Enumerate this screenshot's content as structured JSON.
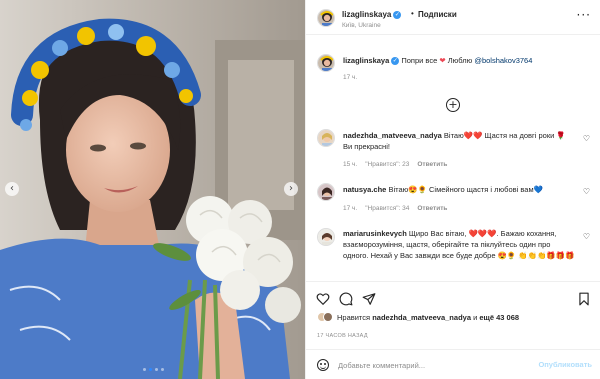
{
  "post": {
    "author": "lizaglinskaya",
    "follow_label": "Подписки",
    "header_separator": "•",
    "location": "Київ, Ukraine",
    "more_icon": "more-horizontal-icon"
  },
  "caption": {
    "username": "lizaglinskaya",
    "text_before": " Попри все ",
    "text_after": " Люблю ",
    "mention": "@bolshakov3764",
    "time": "17 ч."
  },
  "load_more_icon": "plus-circle-icon",
  "comments": [
    {
      "username": "nadezhda_matveeva_nadya",
      "text": " Вітаю❤️❤️ Щастя на довгі роки 🌹 Ви прекрасні!",
      "time": "15 ч.",
      "likes": "\"Нравится\": 23",
      "reply": "Ответить"
    },
    {
      "username": "natusya.che",
      "text": " Вітаю😍🌻 Сімейного щастя і любові вам💙",
      "time": "17 ч.",
      "likes": "\"Нравится\": 34",
      "reply": "Ответить"
    },
    {
      "username": "mariarusinkevych",
      "text": " Щиро Вас вітаю, ❤️❤️❤️. Бажаю кохання, взаєморозуміння, щастя, оберігайте та піклуйтесь один про одного. Нехай у Вас завжди все буде добре 😍🌻 👏👏👏🎁🎁🎁",
      "time": "",
      "likes": "",
      "reply": ""
    }
  ],
  "likes_line": {
    "prefix": "Нравится ",
    "user": "nadezhda_matveeva_nadya",
    "middle": " и ",
    "others": "ещё 43 068"
  },
  "post_time": "17 ЧАСОВ НАЗАД",
  "add_comment": {
    "placeholder": "Добавьте комментарий...",
    "publish_label": "Опубликовать"
  },
  "icons": [
    "heart-icon",
    "comment-icon",
    "share-icon",
    "bookmark-icon",
    "smile-icon",
    "chevron-left-icon",
    "chevron-right-icon"
  ],
  "colors": {
    "verified": "#3897f0",
    "link": "#00376b",
    "meta": "#8e8e8e",
    "publish_disabled": "#b2dffc",
    "wreath_blue": "#2b5fb3",
    "wreath_yellow": "#f2c400",
    "dress_blue": "#4d7bc8"
  }
}
